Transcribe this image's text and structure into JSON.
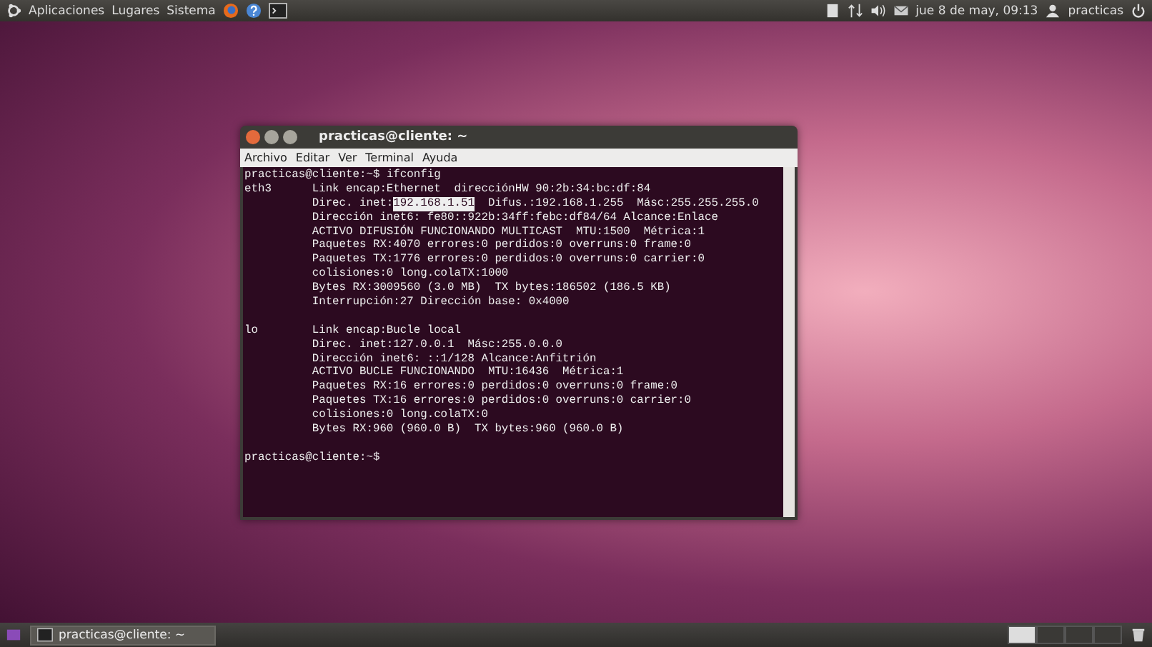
{
  "top_panel": {
    "menus": [
      "Aplicaciones",
      "Lugares",
      "Sistema"
    ],
    "clock": "jue  8 de may, 09:13",
    "user": "practicas"
  },
  "terminal": {
    "title": "practicas@cliente: ~",
    "menu": [
      "Archivo",
      "Editar",
      "Ver",
      "Terminal",
      "Ayuda"
    ],
    "lines": [
      {
        "label": "practicas@cliente:~$ ifconfig"
      },
      {
        "label": "eth3",
        "text": "Link encap:Ethernet  direcciónHW 90:2b:34:bc:df:84"
      },
      {
        "text": "Direc. inet:",
        "highlight": "192.168.1.51",
        "after": "  Difus.:192.168.1.255  Másc:255.255.255.0"
      },
      {
        "text": "Dirección inet6: fe80::922b:34ff:febc:df84/64 Alcance:Enlace"
      },
      {
        "text": "ACTIVO DIFUSIÓN FUNCIONANDO MULTICAST  MTU:1500  Métrica:1"
      },
      {
        "text": "Paquetes RX:4070 errores:0 perdidos:0 overruns:0 frame:0"
      },
      {
        "text": "Paquetes TX:1776 errores:0 perdidos:0 overruns:0 carrier:0"
      },
      {
        "text": "colisiones:0 long.colaTX:1000"
      },
      {
        "text": "Bytes RX:3009560 (3.0 MB)  TX bytes:186502 (186.5 KB)"
      },
      {
        "text": "Interrupción:27 Dirección base: 0x4000"
      },
      {
        "label": "lo",
        "blank_line_before": true,
        "text": "Link encap:Bucle local"
      },
      {
        "text": "Direc. inet:127.0.0.1  Másc:255.0.0.0"
      },
      {
        "text": "Dirección inet6: ::1/128 Alcance:Anfitrión"
      },
      {
        "text": "ACTIVO BUCLE FUNCIONANDO  MTU:16436  Métrica:1"
      },
      {
        "text": "Paquetes RX:16 errores:0 perdidos:0 overruns:0 frame:0"
      },
      {
        "text": "Paquetes TX:16 errores:0 perdidos:0 overruns:0 carrier:0"
      },
      {
        "text": "colisiones:0 long.colaTX:0"
      },
      {
        "text": "Bytes RX:960 (960.0 B)  TX bytes:960 (960.0 B)"
      },
      {
        "label": "practicas@cliente:~$",
        "blank_line_before": true
      }
    ]
  },
  "taskbar": {
    "window_button": "practicas@cliente: ~"
  }
}
